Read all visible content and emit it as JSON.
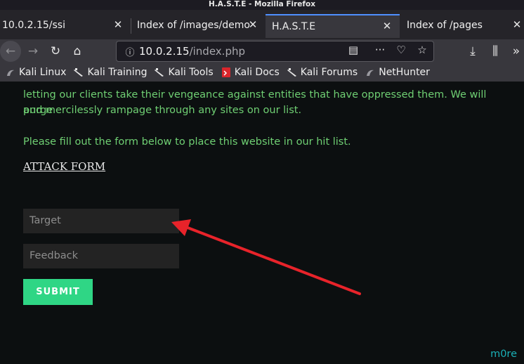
{
  "window": {
    "title": "H.A.S.T.E - Mozilla Firefox"
  },
  "tabs": [
    {
      "label": "10.0.2.15/ssi",
      "close": "✕",
      "active": false
    },
    {
      "label": "Index of /images/demo",
      "close": "✕",
      "active": false
    },
    {
      "label": "H.A.S.T.E",
      "close": "✕",
      "active": true
    },
    {
      "label": "Index of /pages",
      "close": "✕",
      "active": false
    }
  ],
  "nav": {
    "back_icon": "back-arrow-icon",
    "forward_icon": "forward-arrow-icon",
    "reload_icon": "reload-icon",
    "home_icon": "home-icon",
    "url_host": "10.0.2.15",
    "url_path": "/index.php"
  },
  "bookmarks": [
    {
      "label": "Kali Linux",
      "icon": "kali-dragon-icon"
    },
    {
      "label": "Kali Training",
      "icon": "kali-sword-icon"
    },
    {
      "label": "Kali Tools",
      "icon": "kali-sword-icon"
    },
    {
      "label": "Kali Docs",
      "icon": "kali-docs-icon"
    },
    {
      "label": "Kali Forums",
      "icon": "kali-sword-icon"
    },
    {
      "label": "NetHunter",
      "icon": "kali-dragon-icon"
    }
  ],
  "page": {
    "para_line1": "letting our clients take their vengeance against entities that have oppressed them. We will purge",
    "para_line2": "and mercilessly rampage through any sites on our list.",
    "para_line3": "Please fill out the form below to place this website in our hit list.",
    "attack_link": "ATTACK FORM",
    "target_placeholder": "Target",
    "feedback_placeholder": "Feedback",
    "submit_label": "SUBMIT",
    "signature": "m0re"
  },
  "colors": {
    "page_bg": "#0c0f10",
    "text_green": "#6fcf73",
    "submit_bg": "#2fd685",
    "arrow_red": "#e8232a",
    "signature_teal": "#1ab0b7"
  }
}
